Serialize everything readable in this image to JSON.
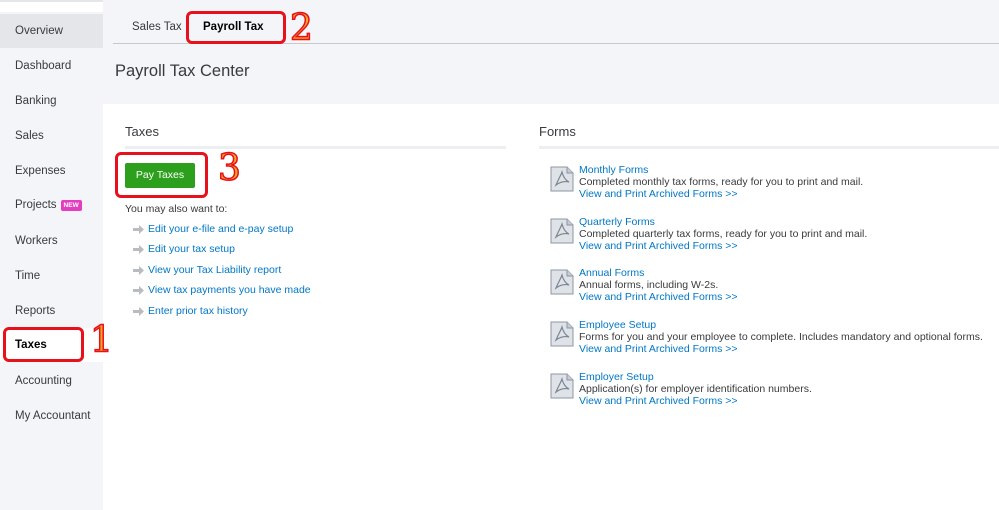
{
  "sidebar": {
    "items": [
      {
        "label": "Overview"
      },
      {
        "label": "Dashboard"
      },
      {
        "label": "Banking"
      },
      {
        "label": "Sales"
      },
      {
        "label": "Expenses"
      },
      {
        "label": "Projects",
        "badge": "NEW"
      },
      {
        "label": "Workers"
      },
      {
        "label": "Time"
      },
      {
        "label": "Reports"
      },
      {
        "label": "Taxes"
      },
      {
        "label": "Accounting"
      },
      {
        "label": "My Accountant"
      }
    ]
  },
  "tabs": [
    {
      "label": "Sales Tax"
    },
    {
      "label": "Payroll Tax"
    }
  ],
  "page_title": "Payroll Tax Center",
  "taxes": {
    "title": "Taxes",
    "pay_button": "Pay Taxes",
    "hint": "You may also want to:",
    "links": [
      {
        "label": "Edit your e-file and e-pay setup"
      },
      {
        "label": "Edit your tax setup"
      },
      {
        "label": "View your Tax Liability report"
      },
      {
        "label": "View tax payments you have made"
      },
      {
        "label": "Enter prior tax history"
      }
    ]
  },
  "forms": {
    "title": "Forms",
    "items": [
      {
        "title": "Monthly Forms",
        "desc": "Completed monthly tax forms, ready for you to print and mail.",
        "link": "View and Print Archived Forms >>"
      },
      {
        "title": "Quarterly Forms",
        "desc": "Completed quarterly tax forms, ready for you to print and mail.",
        "link": "View and Print Archived Forms >>"
      },
      {
        "title": "Annual Forms",
        "desc": "Annual forms, including W-2s.",
        "link": "View and Print Archived Forms >>"
      },
      {
        "title": "Employee Setup",
        "desc": "Forms for you and your employee to complete. Includes mandatory and optional forms.",
        "link": "View and Print Archived Forms >>"
      },
      {
        "title": "Employer Setup",
        "desc": "Application(s) for employer identification numbers.",
        "link": "View and Print Archived Forms >>"
      }
    ]
  },
  "annotations": {
    "one": "1",
    "two": "2",
    "three": "3"
  },
  "colors": {
    "accent_green": "#2ca01c",
    "link_blue": "#0077c5",
    "annotation_red": "#e8101a",
    "annotation_orange": "#f5a623"
  }
}
